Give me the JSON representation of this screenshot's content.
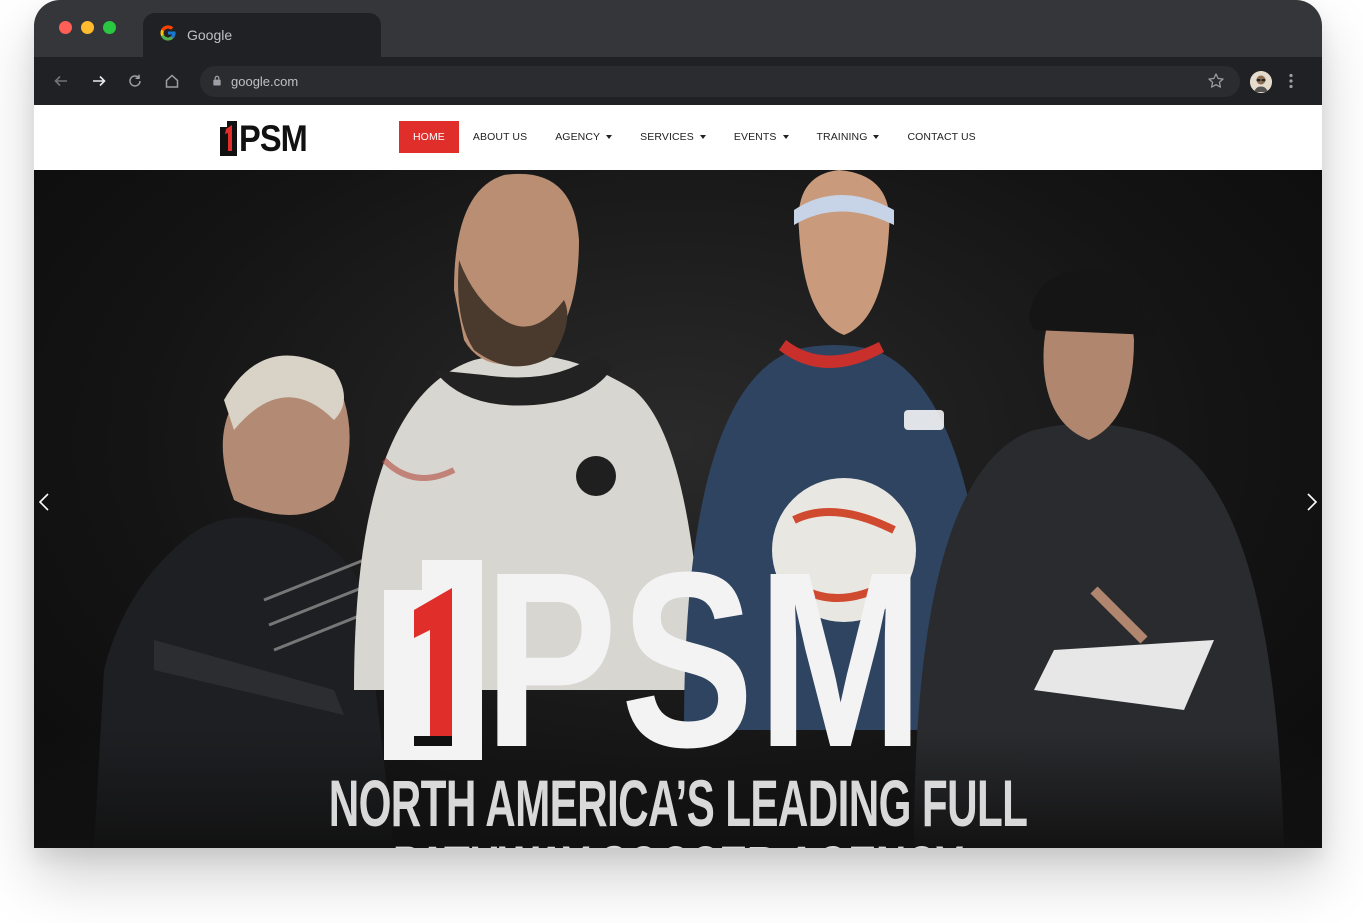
{
  "browser": {
    "tab_title": "Google",
    "url": "google.com",
    "traffic_lights": [
      "#ff5f57",
      "#febc2e",
      "#28c840"
    ]
  },
  "site": {
    "logo_text": "PSM",
    "nav": [
      {
        "label": "HOME",
        "active": true,
        "dropdown": false
      },
      {
        "label": "ABOUT US",
        "active": false,
        "dropdown": false
      },
      {
        "label": "AGENCY",
        "active": false,
        "dropdown": true
      },
      {
        "label": "SERVICES",
        "active": false,
        "dropdown": true
      },
      {
        "label": "EVENTS",
        "active": false,
        "dropdown": true
      },
      {
        "label": "TRAINING",
        "active": false,
        "dropdown": true
      },
      {
        "label": "CONTACT US",
        "active": false,
        "dropdown": false
      }
    ],
    "accent_color": "#e02f2a"
  },
  "hero": {
    "logo_text": "PSM",
    "tagline": "NORTH AMERICA’S LEADING FULL PATHWAY SOCCER AGENCY"
  }
}
